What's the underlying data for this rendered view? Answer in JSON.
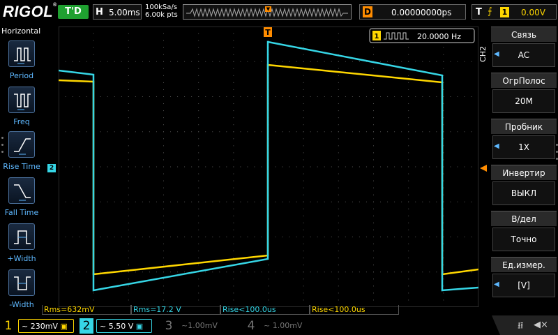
{
  "header": {
    "brand": "RIGOL",
    "trigger_status": "T'D",
    "timebase_key": "H",
    "timebase": "5.00ms",
    "sample_rate": "100kSa/s",
    "memory_depth": "6.00k pts",
    "delay_key": "D",
    "delay": "0.00000000ps",
    "trigger_key": "T",
    "trigger_source": "1",
    "trigger_level": "0.00V"
  },
  "left_menu": {
    "title": "Horizontal",
    "items": [
      {
        "label": "Period",
        "icon": "period-icon"
      },
      {
        "label": "Freq",
        "icon": "freq-icon"
      },
      {
        "label": "Rise Time",
        "icon": "rise-time-icon"
      },
      {
        "label": "Fall Time",
        "icon": "fall-time-icon"
      },
      {
        "label": "+Width",
        "icon": "plus-width-icon"
      },
      {
        "label": "-Width",
        "icon": "minus-width-icon"
      }
    ]
  },
  "right_menu": {
    "channel_tag": "CH2",
    "items": [
      {
        "label": "Связь",
        "value": "AC",
        "arrow": true
      },
      {
        "label": "ОгрПолос",
        "value": "20M",
        "arrow": false
      },
      {
        "label": "Пробник",
        "value": "1X",
        "arrow": true
      },
      {
        "label": "Инвертир",
        "value": "ВЫКЛ",
        "arrow": false
      },
      {
        "label": "В/дел",
        "value": "Точно",
        "arrow": false
      },
      {
        "label": "Ед.измер.",
        "value": "[V]",
        "arrow": true
      }
    ]
  },
  "frequency_counter": {
    "channel": "1",
    "value": "20.0000 Hz"
  },
  "markers": {
    "ch2_marker": "2",
    "trigger_marker": "T"
  },
  "measurements": [
    {
      "text": "Rms=632mV",
      "channel": 1
    },
    {
      "text": "Rms=17.2 V",
      "channel": 2
    },
    {
      "text": "Rise<100.0us",
      "channel": 2
    },
    {
      "text": "Rise<100.0us",
      "channel": 1
    }
  ],
  "channels": [
    {
      "num": "1",
      "coupling": "~",
      "scale": "230mV"
    },
    {
      "num": "2",
      "coupling": "~",
      "scale": "5.50 V"
    },
    {
      "num": "3",
      "coupling": "~",
      "scale": "1.00mV"
    },
    {
      "num": "4",
      "coupling": "~",
      "scale": "1.00mV"
    }
  ],
  "colors": {
    "ch1": "#ffd700",
    "ch2": "#36d6e6",
    "trigger": "#ff8c00",
    "menu_label": "#5eb8ff"
  }
}
